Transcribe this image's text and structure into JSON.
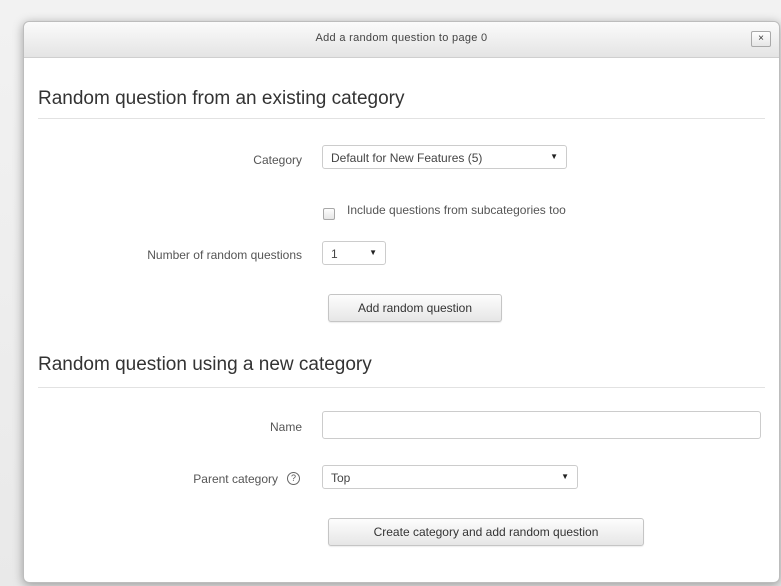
{
  "dialog": {
    "title": "Add a random question to page 0",
    "close_label": "×"
  },
  "existing_category": {
    "heading": "Random question from an existing category",
    "category_label": "Category",
    "category_value": "Default for New Features (5)",
    "include_subcategories_label": "Include questions from subcategories too",
    "include_subcategories_checked": false,
    "num_questions_label": "Number of random questions",
    "num_questions_value": "1",
    "add_button_label": "Add random question"
  },
  "new_category": {
    "heading": "Random question using a new category",
    "name_label": "Name",
    "name_value": "",
    "parent_label": "Parent category",
    "parent_value": "Top",
    "help_icon_glyph": "?",
    "create_button_label": "Create category and add random question"
  },
  "icons": {
    "dropdown_caret": "▼"
  }
}
